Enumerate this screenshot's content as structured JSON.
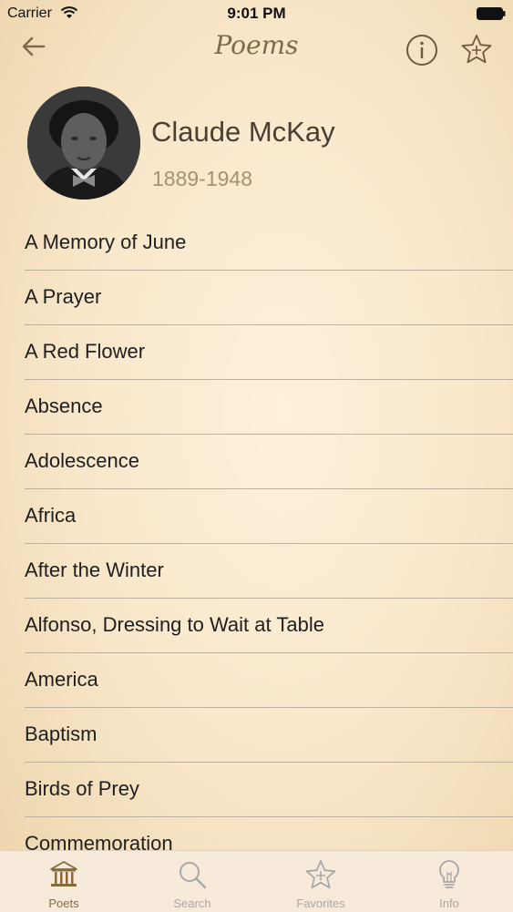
{
  "status_bar": {
    "carrier": "Carrier",
    "time": "9:01 PM"
  },
  "nav": {
    "title": "Poems"
  },
  "poet": {
    "name": "Claude McKay",
    "dates": "1889-1948"
  },
  "poems": [
    "A Memory of June",
    "A Prayer",
    "A Red Flower",
    "Absence",
    "Adolescence",
    "Africa",
    "After the Winter",
    "Alfonso, Dressing to Wait at Table",
    "America",
    "Baptism",
    "Birds of Prey",
    "Commemoration"
  ],
  "tabs": [
    {
      "label": "Poets",
      "icon": "museum-icon",
      "active": true
    },
    {
      "label": "Search",
      "icon": "search-icon",
      "active": false
    },
    {
      "label": "Favorites",
      "icon": "star-icon",
      "active": false
    },
    {
      "label": "Info",
      "icon": "lightbulb-icon",
      "active": false
    }
  ],
  "colors": {
    "accent": "#8a6a3a",
    "title": "#7d6a4a",
    "dates": "#a69173"
  }
}
